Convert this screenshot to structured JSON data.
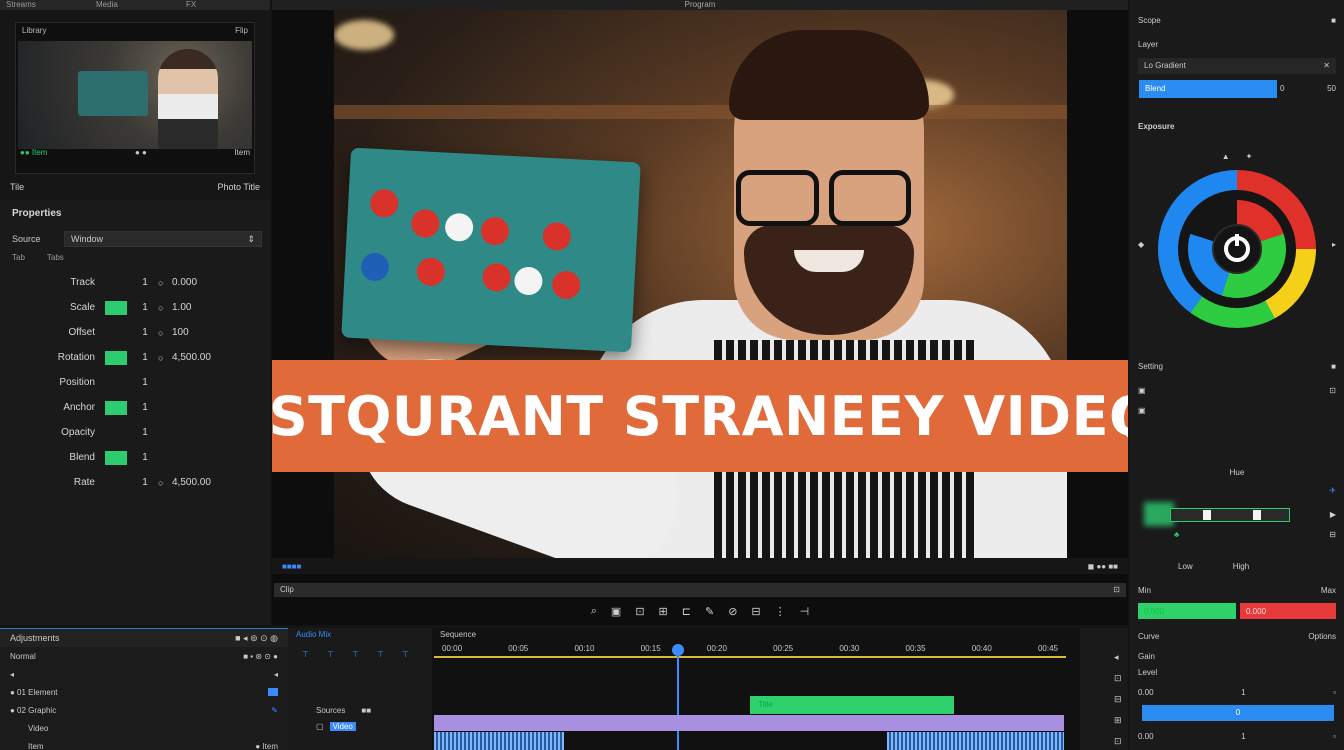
{
  "left_top": {
    "tabs": [
      "Streams",
      "Media",
      "FX"
    ],
    "thumb_header": [
      "Library",
      "Flip"
    ],
    "thumb_footer": [
      "●● Item",
      "● ●",
      "Item"
    ],
    "bar_left": "Tile",
    "bar_right": "Photo Title"
  },
  "properties": {
    "title": "Properties",
    "select_label": "Source",
    "select_value": "Window",
    "sub": [
      "Tab",
      "Tabs"
    ],
    "rows": [
      {
        "name": "Track",
        "num": "1",
        "val": "0.000",
        "on": false
      },
      {
        "name": "Scale",
        "num": "1",
        "val": "1.00",
        "on": true
      },
      {
        "name": "Offset",
        "num": "1",
        "val": "100",
        "on": false
      },
      {
        "name": "Rotation",
        "num": "1",
        "val": "4,500.00",
        "on": true
      },
      {
        "name": "Position",
        "num": "1",
        "val": "",
        "on": false
      },
      {
        "name": "Anchor",
        "num": "1",
        "val": "",
        "on": true
      },
      {
        "name": "Opacity",
        "num": "1",
        "val": "",
        "on": false
      },
      {
        "name": "Blend",
        "num": "1",
        "val": "",
        "on": true
      },
      {
        "name": "Rate",
        "num": "1",
        "val": "4,500.00",
        "on": false
      }
    ]
  },
  "preview": {
    "header": "Program",
    "banner_text": "DESTQURANT STRANEEY VIDEO",
    "bar_left": "■■■■",
    "bar_right": "◼ ●● ■■",
    "scrub_label": "Clip",
    "tools": [
      "⌕",
      "▣",
      "⊡",
      "⊞",
      "⊏",
      "✎",
      "⊘",
      "⊟",
      "⋮",
      "⊣"
    ]
  },
  "right": {
    "top_row": [
      "Scope",
      "■"
    ],
    "field_label": "Layer",
    "field_value": "Lo Gradient",
    "blue_label": "Blend",
    "blue_vals": [
      "0",
      "50"
    ],
    "section": "Exposure",
    "section2": "Setting",
    "slider_label": "Hue",
    "slider_knob1": 0.3,
    "slider_knob2": 0.72,
    "split": [
      "Min",
      "Max"
    ],
    "green_label": "0.000",
    "red_label": "0.000",
    "section3": "Curve",
    "sub_label": "Gain",
    "rows": [
      {
        "a": "0.00",
        "b": "1"
      },
      {
        "a": "0.00",
        "b": "1"
      }
    ],
    "blue2": "0"
  },
  "bottom_left": {
    "title": "Adjustments",
    "rows": [
      "Normal",
      "● 01 Element",
      "● 02 Graphic",
      "Video",
      "Item"
    ]
  },
  "bottom_mid": {
    "title": "Audio Mix",
    "labels": [
      "Sources",
      "Video"
    ]
  },
  "timeline": {
    "title": "Sequence",
    "ticks": [
      "00:00",
      "00:05",
      "00:10",
      "00:15",
      "00:20",
      "00:25",
      "00:30",
      "00:35",
      "00:40",
      "00:45"
    ],
    "green_clip": "Title"
  },
  "colors": {
    "accent_blue": "#2a8cf0",
    "accent_green": "#2ed16c",
    "accent_red": "#e83a3a",
    "banner": "#e06a3a"
  }
}
